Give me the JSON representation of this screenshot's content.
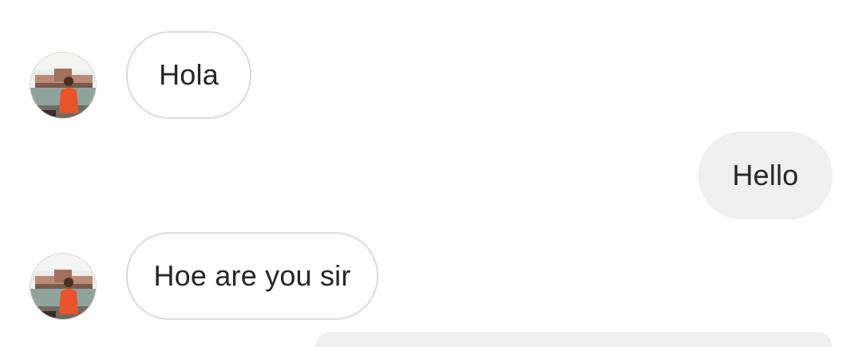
{
  "messages": [
    {
      "direction": "incoming",
      "text": "Hola",
      "sender_avatar": "user-avatar-photo"
    },
    {
      "direction": "outgoing",
      "text": "Hello"
    },
    {
      "direction": "incoming",
      "text": "Hoe are you sir",
      "sender_avatar": "user-avatar-photo"
    },
    {
      "direction": "outgoing",
      "text": ""
    }
  ],
  "colors": {
    "incoming_border": "#dbdbdb",
    "outgoing_background": "#efefef",
    "text": "#262626",
    "page_background": "#ffffff"
  }
}
